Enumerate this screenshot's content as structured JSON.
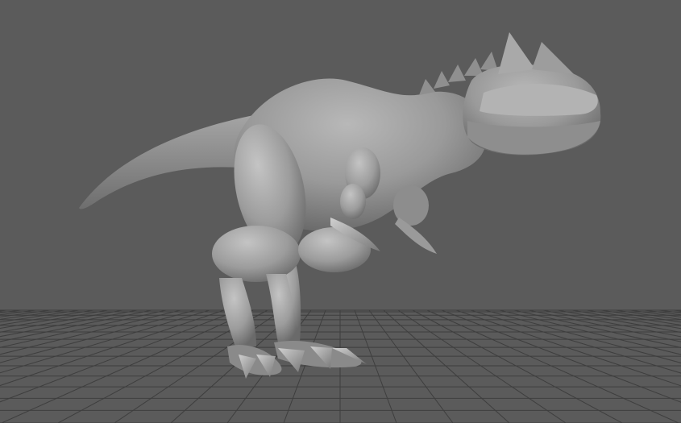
{
  "viewport": {
    "background_color": "#5b5b5b",
    "grid_color": "#3e3e3e",
    "model_color": "#9a9a9a",
    "model": "dinosaur-sculpt",
    "grid_visible": true
  }
}
